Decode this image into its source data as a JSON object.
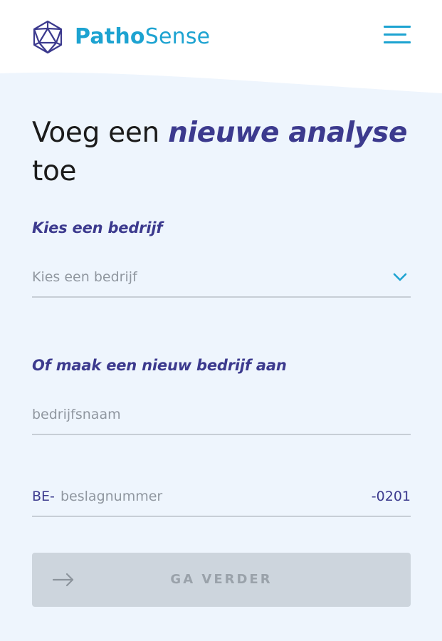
{
  "brand": {
    "name_bold": "Patho",
    "name_light": "Sense",
    "color": "#1da3d1",
    "logo_icon": "icosahedron-icon"
  },
  "header": {
    "menu_icon": "hamburger-menu-icon"
  },
  "heading": {
    "line1_plain": "Voeg een ",
    "line1_accent": "nieuwe analyse",
    "line2": "toe"
  },
  "company_select": {
    "label": "Kies een bedrijf",
    "placeholder": "Kies een bedrijf",
    "icon": "chevron-down-icon"
  },
  "new_company": {
    "label": "Of maak een nieuw bedrijf aan",
    "name_placeholder": "bedrijfsnaam",
    "seizure_prefix": "BE-",
    "seizure_placeholder": "beslagnummer",
    "seizure_suffix": "-0201"
  },
  "submit": {
    "label": "GA VERDER",
    "icon": "arrow-right-icon",
    "enabled": false
  },
  "colors": {
    "accent": "#3c3a8e",
    "background": "#eef5fd",
    "button_disabled": "#cdd5dd"
  }
}
